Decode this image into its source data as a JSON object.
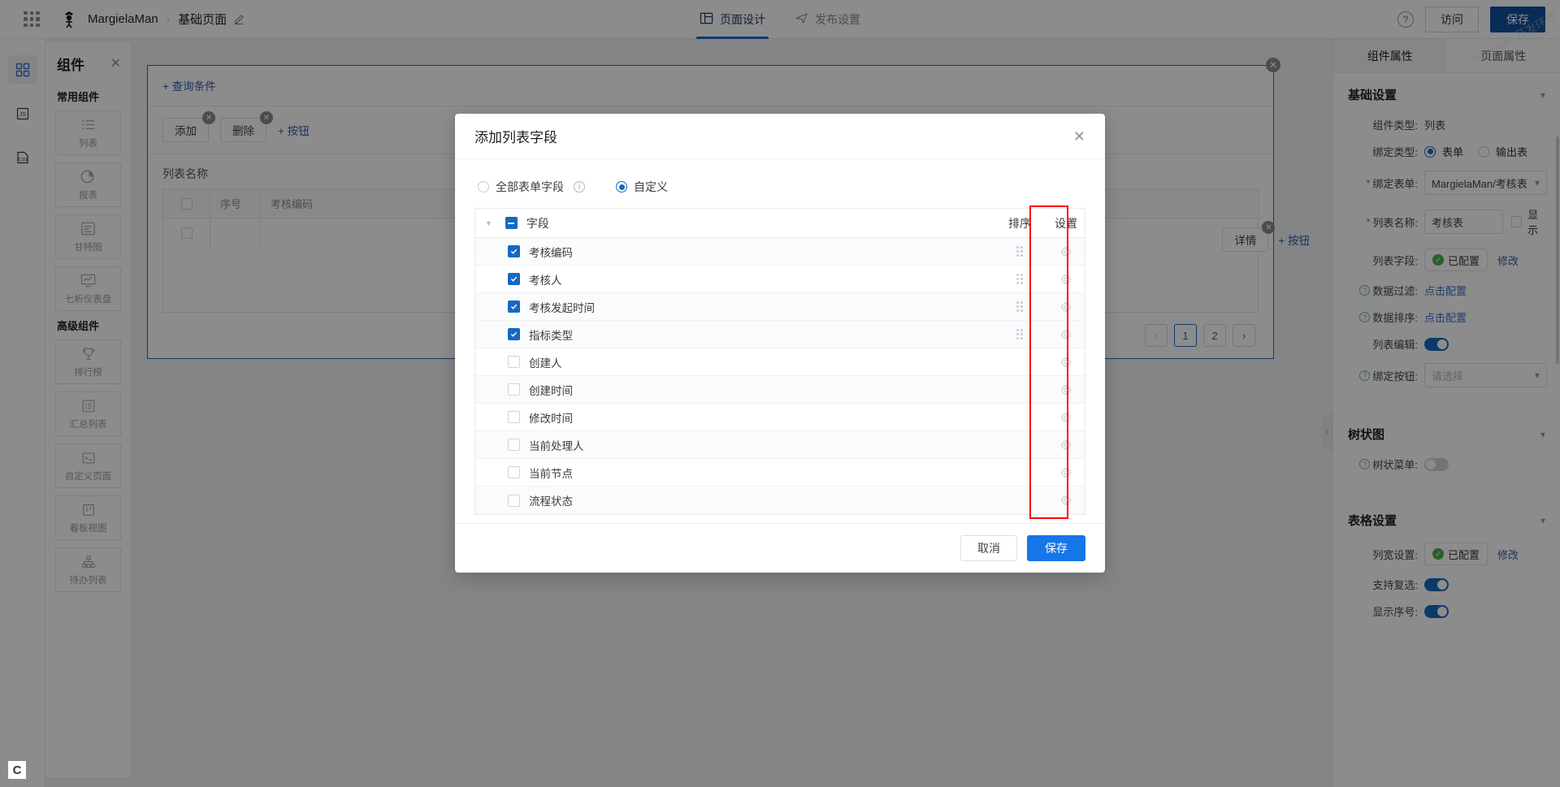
{
  "topbar": {
    "app_launcher_icon": "grid-apps-icon",
    "logo_icon": "brand-logo-icon",
    "brand": "MargielaMan",
    "breadcrumb_separator": "›",
    "page_name": "基础页面",
    "edit_icon": "pencil-icon",
    "nav": [
      {
        "label": "页面设计",
        "icon": "layout-icon",
        "active": true
      },
      {
        "label": "发布设置",
        "icon": "send-icon",
        "active": false
      }
    ],
    "help_icon": "question-icon",
    "visit_label": "访问",
    "save_label": "保存"
  },
  "rail": [
    {
      "icon": "components-grid-icon",
      "active": true
    },
    {
      "icon": "js-file-icon",
      "active": false
    },
    {
      "icon": "css-file-icon",
      "active": false
    }
  ],
  "components_panel": {
    "title": "组件",
    "close_icon": "close-icon",
    "groups": [
      {
        "label": "常用组件",
        "items": [
          {
            "label": "列表",
            "icon": "list-icon"
          },
          {
            "label": "报表",
            "icon": "pie-chart-icon"
          },
          {
            "label": "甘特图",
            "icon": "gantt-icon"
          },
          {
            "label": "七析仪表盘",
            "icon": "dashboard-monitor-icon"
          }
        ]
      },
      {
        "label": "高级组件",
        "items": [
          {
            "label": "排行榜",
            "icon": "trophy-icon"
          },
          {
            "label": "汇总列表",
            "icon": "summary-list-icon"
          },
          {
            "label": "自定义页面",
            "icon": "terminal-icon"
          },
          {
            "label": "看板视图",
            "icon": "kanban-icon"
          },
          {
            "label": "待办列表",
            "icon": "sitemap-icon"
          }
        ]
      }
    ]
  },
  "canvas": {
    "widget_close_icon": "close-icon",
    "query_condition_label": "+ 查询条件",
    "buttons": [
      {
        "label": "添加",
        "remove_icon": "remove-icon"
      },
      {
        "label": "删除",
        "remove_icon": "remove-icon"
      }
    ],
    "add_button_label": "+ 按钮",
    "list_name_label": "列表名称",
    "table_headers": [
      "序号",
      "考核编码"
    ],
    "detail_button": {
      "label": "详情",
      "remove_icon": "remove-icon"
    },
    "detail_add_button_label": "+ 按钮",
    "pagination": {
      "prev_icon": "chevron-left-icon",
      "next_icon": "chevron-right-icon",
      "pages": [
        "1",
        "2"
      ],
      "current": "1"
    },
    "collapse_handle_icon": "chevron-right-icon"
  },
  "modal": {
    "title": "添加列表字段",
    "close_icon": "close-icon",
    "radios": [
      {
        "label": "全部表单字段",
        "selected": false,
        "info_icon": "info-icon"
      },
      {
        "label": "自定义",
        "selected": true
      }
    ],
    "table": {
      "caret_icon": "caret-down-icon",
      "header": {
        "field": "字段",
        "sort": "排序",
        "settings": "设置"
      },
      "header_checkbox_state": "indeterminate",
      "rows": [
        {
          "label": "考核编码",
          "checked": true,
          "drag_icon": "drag-handle-icon",
          "gear_icon": "gear-icon"
        },
        {
          "label": "考核人",
          "checked": true,
          "drag_icon": "drag-handle-icon",
          "gear_icon": "gear-icon"
        },
        {
          "label": "考核发起时间",
          "checked": true,
          "drag_icon": "drag-handle-icon",
          "gear_icon": "gear-icon"
        },
        {
          "label": "指标类型",
          "checked": true,
          "drag_icon": "drag-handle-icon",
          "gear_icon": "gear-icon"
        },
        {
          "label": "创建人",
          "checked": false,
          "drag_icon": "",
          "gear_icon": "gear-icon"
        },
        {
          "label": "创建时间",
          "checked": false,
          "drag_icon": "",
          "gear_icon": "gear-icon"
        },
        {
          "label": "修改时间",
          "checked": false,
          "drag_icon": "",
          "gear_icon": "gear-icon"
        },
        {
          "label": "当前处理人",
          "checked": false,
          "drag_icon": "",
          "gear_icon": "gear-icon"
        },
        {
          "label": "当前节点",
          "checked": false,
          "drag_icon": "",
          "gear_icon": "gear-icon"
        },
        {
          "label": "流程状态",
          "checked": false,
          "drag_icon": "",
          "gear_icon": "gear-icon"
        }
      ],
      "highlight_color": "#ff0000"
    },
    "cancel_label": "取消",
    "save_label": "保存"
  },
  "right_panel": {
    "tabs": [
      {
        "label": "组件属性",
        "active": true
      },
      {
        "label": "页面属性",
        "active": false
      }
    ],
    "sections": [
      {
        "title": "基础设置",
        "chevron_icon": "chevron-down-icon",
        "rows": [
          {
            "type": "text",
            "label": "组件类型:",
            "value": "列表"
          },
          {
            "type": "radio",
            "label": "绑定类型:",
            "options": [
              {
                "label": "表单",
                "selected": true
              },
              {
                "label": "输出表",
                "selected": false
              }
            ]
          },
          {
            "type": "select",
            "label": "绑定表单:",
            "required": true,
            "value": "MargielaMan/考核表",
            "chevron_icon": "chevron-down-icon"
          },
          {
            "type": "input_checkbox",
            "label": "列表名称:",
            "required": true,
            "value": "考核表",
            "checkbox_label": "显示",
            "checked": false
          },
          {
            "type": "configured",
            "label": "列表字段:",
            "status": "已配置",
            "status_icon": "check-circle-icon",
            "action": "修改"
          },
          {
            "type": "link",
            "label": "数据过滤:",
            "help_icon": "question-icon",
            "link": "点击配置"
          },
          {
            "type": "link",
            "label": "数据排序:",
            "help_icon": "question-icon",
            "link": "点击配置"
          },
          {
            "type": "toggle",
            "label": "列表编辑:",
            "on": true
          },
          {
            "type": "select",
            "label": "绑定按钮:",
            "help_icon": "question-icon",
            "placeholder": "请选择",
            "value": "",
            "chevron_icon": "chevron-down-icon"
          }
        ]
      },
      {
        "title": "树状图",
        "chevron_icon": "chevron-down-icon",
        "rows": [
          {
            "type": "toggle",
            "label": "树状菜单:",
            "help_icon": "question-icon",
            "on": false
          }
        ]
      },
      {
        "title": "表格设置",
        "chevron_icon": "chevron-down-icon",
        "rows": [
          {
            "type": "configured",
            "label": "列宽设置:",
            "status": "已配置",
            "status_icon": "check-circle-icon",
            "action": "修改"
          },
          {
            "type": "toggle",
            "label": "支持复选:",
            "on": true
          },
          {
            "type": "toggle",
            "label": "显示序号:",
            "on": true
          }
        ]
      }
    ]
  },
  "watermark": "aas-paas 开发环境",
  "corner_badge": "C",
  "colors": {
    "primary": "#1668c1",
    "save_blue": "#1677e8",
    "dark_blue": "#11509e",
    "highlight_red": "#ff0000",
    "success_green": "#4caf50"
  }
}
